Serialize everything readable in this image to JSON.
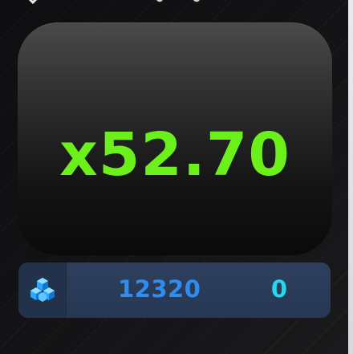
{
  "multiplier": {
    "value": "x52.70",
    "color": "#6cf01c"
  },
  "balance_bar": {
    "currency_icon": "blue-gem-cluster-icon",
    "balance": "12320",
    "bet": "0",
    "balance_color": "#2f8df0",
    "bet_color": "#22d9f2"
  }
}
